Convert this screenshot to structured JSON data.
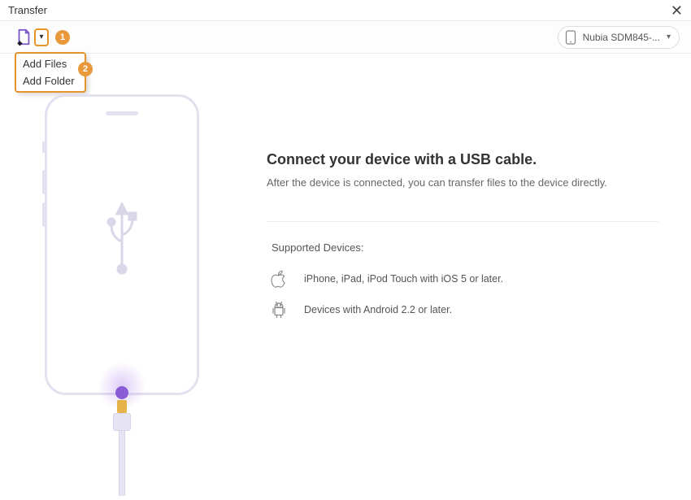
{
  "window": {
    "title": "Transfer"
  },
  "toolbar": {
    "dropdown": {
      "items": [
        {
          "label": "Add Files"
        },
        {
          "label": "Add Folder"
        }
      ]
    },
    "annotations": {
      "step1": "1",
      "step2": "2"
    },
    "device": {
      "label": "Nubia SDM845-..."
    }
  },
  "main": {
    "headline": "Connect your device with a USB cable.",
    "sub": "After the device is connected, you can transfer files to the device directly.",
    "supported_title": "Supported Devices:",
    "apple_line": "iPhone, iPad, iPod Touch with iOS 5 or later.",
    "android_line": "Devices with Android 2.2 or later."
  },
  "icons": {
    "add_file": "add-file-icon",
    "chevron_down": "chevron-down-icon",
    "close": "close-icon",
    "phone_small": "phone-icon",
    "apple": "apple-icon",
    "android": "android-icon",
    "usb": "usb-icon"
  }
}
